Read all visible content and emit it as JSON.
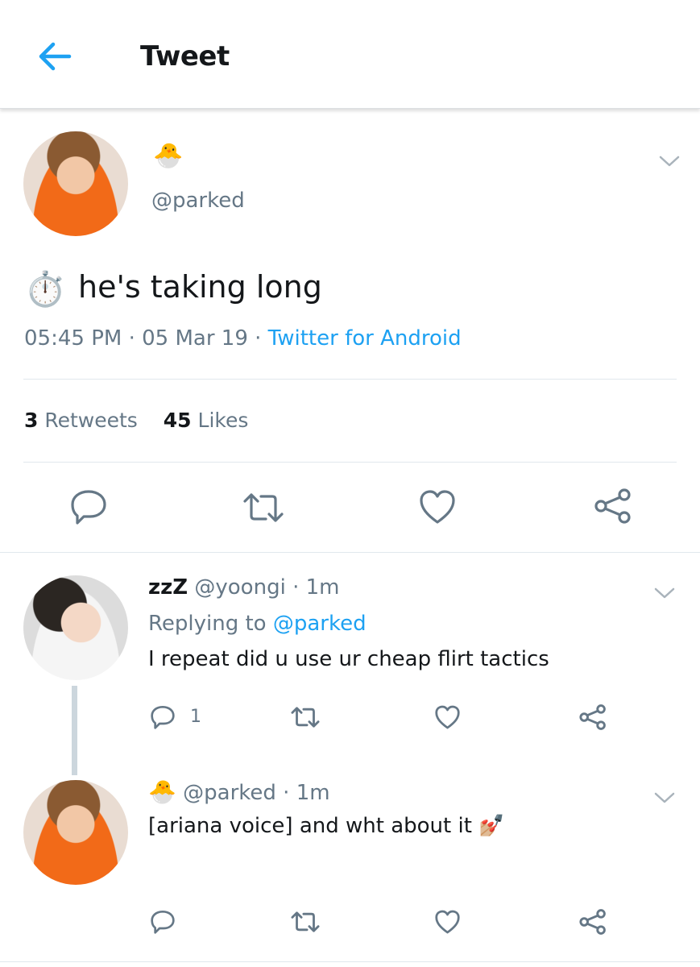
{
  "header": {
    "title": "Tweet",
    "back_icon": "arrow-left-icon"
  },
  "main_tweet": {
    "author_emoji": "🐣",
    "handle": "@parked",
    "text_emoji": "⏱️",
    "text": "he's taking long",
    "time": "05:45 PM",
    "date": "05 Mar 19",
    "sep": "·",
    "source": "Twitter for Android",
    "retweet_count": "3",
    "retweet_label": "Retweets",
    "like_count": "45",
    "like_label": "Likes"
  },
  "replies": [
    {
      "name": "zzZ",
      "handle": "@yoongi",
      "sep": "·",
      "time": "1m",
      "replying_prefix": "Replying to",
      "replying_handle": "@parked",
      "text": "I repeat did u use ur cheap flirt tactics",
      "reply_count": "1"
    },
    {
      "name_emoji": "🐣",
      "handle": "@parked",
      "sep": "·",
      "time": "1m",
      "text": "[ariana voice] and wht about it",
      "text_emoji": "💅🏼"
    }
  ],
  "colors": {
    "accent": "#1da1f2",
    "muted": "#657786",
    "icon": "#657786",
    "divider": "#e1e8ed",
    "thread_line": "#ccd6dd"
  }
}
